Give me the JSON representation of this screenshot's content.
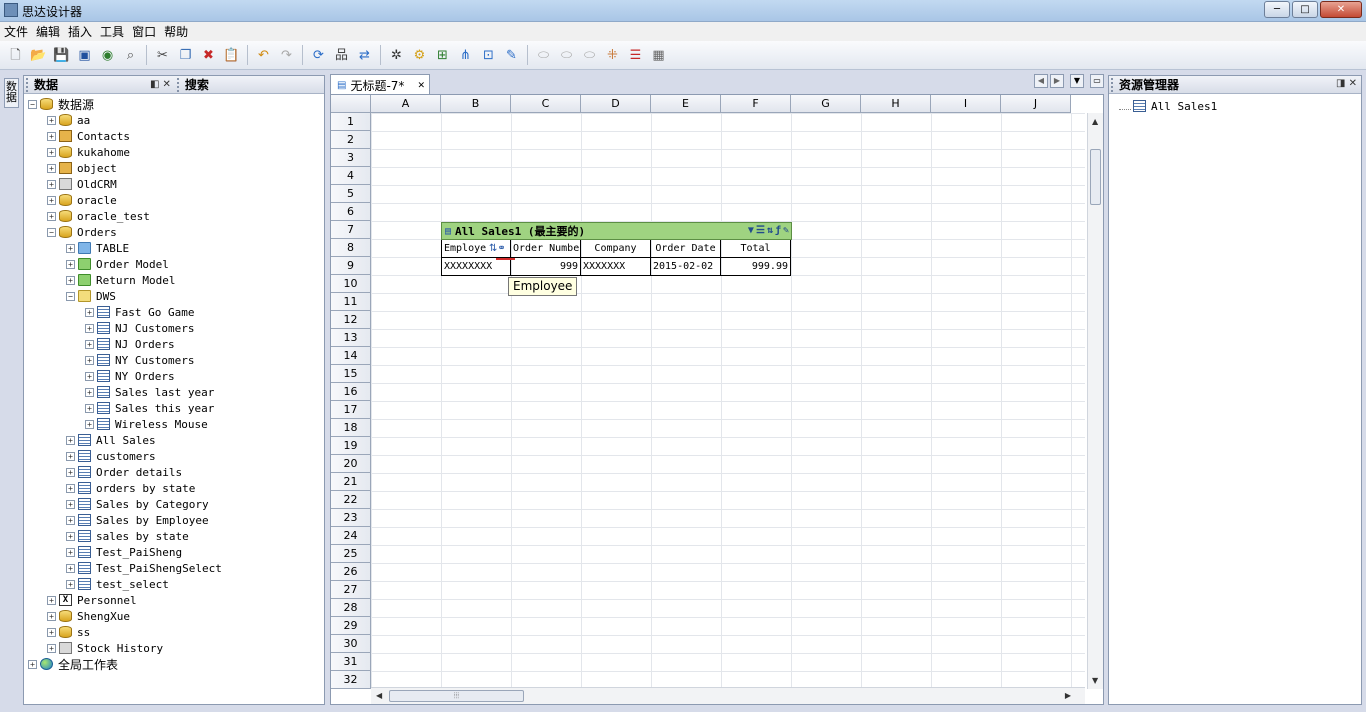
{
  "window": {
    "title": "思达设计器",
    "min_label": "─",
    "max_label": "□",
    "close_label": "✕"
  },
  "menu": [
    "文件",
    "编辑",
    "插入",
    "工具",
    "窗口",
    "帮助"
  ],
  "toolbar": {
    "group1": [
      "new-icon",
      "open-icon",
      "save-icon",
      "save-all-icon",
      "preview-icon",
      "print-preview-icon"
    ],
    "group2": [
      "cut-icon",
      "copy-icon",
      "delete-icon",
      "paste-icon"
    ],
    "group3": [
      "undo-icon",
      "redo-icon"
    ],
    "group4": [
      "refresh-icon",
      "datasource-icon",
      "reload-icon"
    ],
    "group5": [
      "tool-a-icon",
      "tool-b-icon",
      "tool-c-icon",
      "tool-d-icon",
      "tool-e-icon",
      "tool-f-icon"
    ],
    "group6": [
      "merge-icon",
      "split-icon",
      "unmerge-icon",
      "insert-row-icon",
      "delete-row-icon",
      "layout-icon"
    ]
  },
  "vertical_tab": {
    "label": "数据"
  },
  "left_panel": {
    "tab_data": "数据",
    "tab_search": "搜索",
    "tree": [
      {
        "level": 0,
        "icon": "db",
        "label": "数据源",
        "expanded": true,
        "root": true
      },
      {
        "level": 1,
        "icon": "db",
        "label": "aa"
      },
      {
        "level": 1,
        "icon": "obj",
        "label": "Contacts"
      },
      {
        "level": 1,
        "icon": "db",
        "label": "kukahome"
      },
      {
        "level": 1,
        "icon": "obj",
        "label": "object"
      },
      {
        "level": 1,
        "icon": "stk",
        "label": "OldCRM"
      },
      {
        "level": 1,
        "icon": "db",
        "label": "oracle"
      },
      {
        "level": 1,
        "icon": "db",
        "label": "oracle_test"
      },
      {
        "level": 1,
        "icon": "db",
        "label": "Orders",
        "expanded": true
      },
      {
        "level": 2,
        "icon": "folder",
        "label": "TABLE"
      },
      {
        "level": 2,
        "icon": "folderg",
        "label": "Order Model"
      },
      {
        "level": 2,
        "icon": "folderg",
        "label": "Return Model"
      },
      {
        "level": 2,
        "icon": "foldery",
        "label": "DWS",
        "expanded": true
      },
      {
        "level": 3,
        "icon": "table",
        "label": "Fast Go Game"
      },
      {
        "level": 3,
        "icon": "table",
        "label": "NJ Customers"
      },
      {
        "level": 3,
        "icon": "table",
        "label": "NJ Orders"
      },
      {
        "level": 3,
        "icon": "table",
        "label": "NY Customers"
      },
      {
        "level": 3,
        "icon": "table",
        "label": "NY Orders"
      },
      {
        "level": 3,
        "icon": "table",
        "label": "Sales last year"
      },
      {
        "level": 3,
        "icon": "table",
        "label": "Sales this year"
      },
      {
        "level": 3,
        "icon": "table",
        "label": "Wireless Mouse"
      },
      {
        "level": 2,
        "icon": "table",
        "label": "All Sales"
      },
      {
        "level": 2,
        "icon": "table",
        "label": "customers"
      },
      {
        "level": 2,
        "icon": "table",
        "label": "Order details"
      },
      {
        "level": 2,
        "icon": "table",
        "label": "orders by state"
      },
      {
        "level": 2,
        "icon": "table",
        "label": "Sales by Category"
      },
      {
        "level": 2,
        "icon": "table",
        "label": "Sales by Employee"
      },
      {
        "level": 2,
        "icon": "table",
        "label": "sales by state"
      },
      {
        "level": 2,
        "icon": "table",
        "label": "Test_PaiSheng"
      },
      {
        "level": 2,
        "icon": "table",
        "label": "Test_PaiShengSelect"
      },
      {
        "level": 2,
        "icon": "table",
        "label": "test_select"
      },
      {
        "level": 1,
        "icon": "xl",
        "label": "Personnel"
      },
      {
        "level": 1,
        "icon": "db",
        "label": "ShengXue"
      },
      {
        "level": 1,
        "icon": "db",
        "label": "ss"
      },
      {
        "level": 1,
        "icon": "stk",
        "label": "Stock History"
      },
      {
        "level": 0,
        "icon": "globe",
        "label": "全局工作表",
        "root": true
      }
    ]
  },
  "document": {
    "tab_label": "无标题-7*",
    "columns": [
      "A",
      "B",
      "C",
      "D",
      "E",
      "F",
      "G",
      "H",
      "I",
      "J"
    ],
    "rows": [
      "1",
      "2",
      "3",
      "4",
      "5",
      "6",
      "7",
      "8",
      "9",
      "10",
      "11",
      "12",
      "13",
      "14",
      "15",
      "16",
      "17",
      "18",
      "19",
      "20",
      "21",
      "22",
      "23",
      "24",
      "25",
      "26",
      "27",
      "28",
      "29",
      "30",
      "31",
      "32"
    ],
    "data_table": {
      "title": "All Sales1 (最主要的)",
      "headers": [
        "Employe",
        "Order Number",
        "Company",
        "Order Date",
        "Total"
      ],
      "row": [
        "XXXXXXXX",
        "999",
        "XXXXXXX",
        "2015-02-02",
        "999.99"
      ]
    },
    "tooltip": "Employee"
  },
  "right_panel": {
    "title": "资源管理器",
    "items": [
      "All Sales1"
    ]
  }
}
